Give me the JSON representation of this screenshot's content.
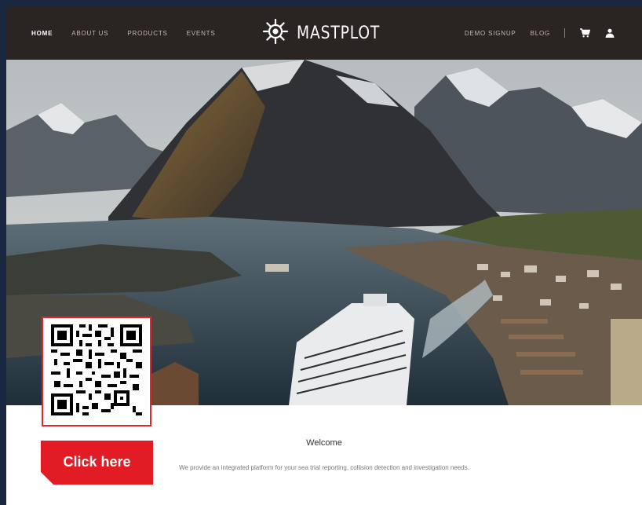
{
  "nav": {
    "left_links": [
      {
        "label": "HOME",
        "active": true
      },
      {
        "label": "ABOUT US",
        "active": false
      },
      {
        "label": "PRODUCTS",
        "active": false
      },
      {
        "label": "EVENTS",
        "active": false
      }
    ],
    "brand": "MASTPLOT",
    "brand_icon": "ship-wheel-icon",
    "right_links": [
      {
        "label": "DEMO SIGNUP"
      },
      {
        "label": "BLOG"
      }
    ],
    "cart_icon": "cart-icon",
    "user_icon": "user-icon"
  },
  "hero": {
    "image": "fjord-mountains-cruise-ship-photo"
  },
  "cta": {
    "qr_icon": "qr-code-icon",
    "button_label": "Click here"
  },
  "welcome": {
    "title": "Welcome",
    "text": "We provide an integrated platform for your sea trial reporting, collision detection and investigation needs."
  },
  "colors": {
    "nav_bg": "#2a2522",
    "accent_red": "#e11c24",
    "page_bg": "#1a2740"
  }
}
